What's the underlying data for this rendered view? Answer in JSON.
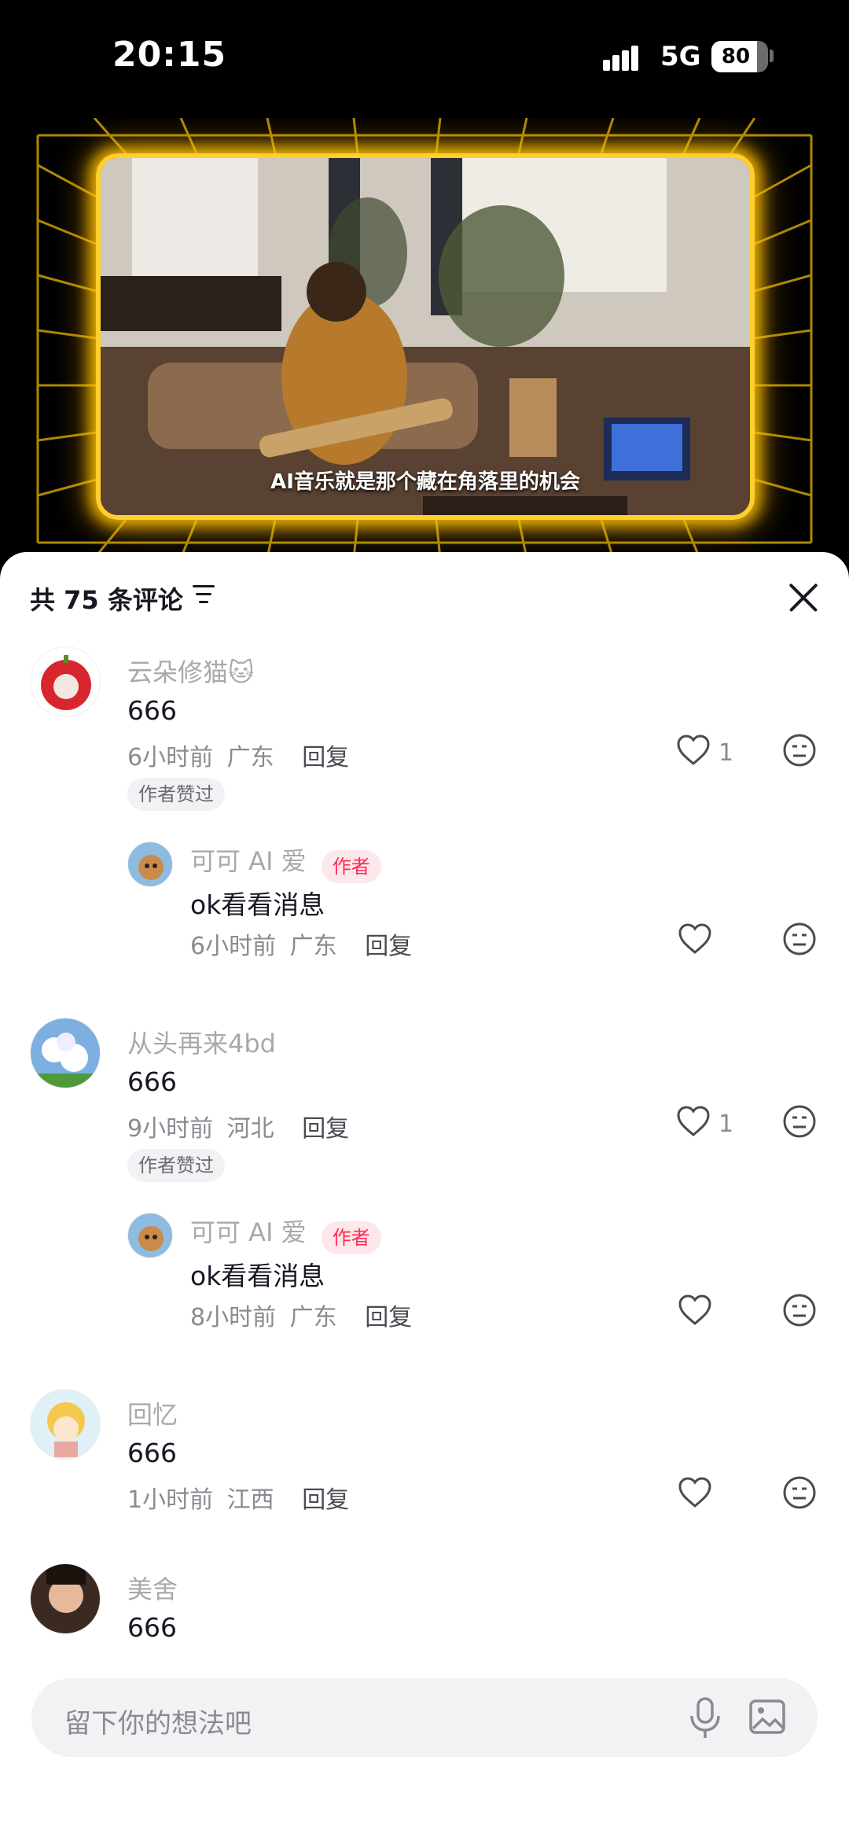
{
  "status_bar": {
    "time": "20:15",
    "network": "5G",
    "battery": "80",
    "battery_level": 0.8
  },
  "video": {
    "subtitle": "AI音乐就是那个藏在角落里的机会"
  },
  "comments_panel": {
    "title": "共 75 条评论",
    "input_placeholder": "留下你的想法吧",
    "comments": [
      {
        "user": "云朵修猫🐱",
        "text": "666",
        "time": "6小时前",
        "location": "广东",
        "reply": "回复",
        "likes": "1",
        "tag": "作者赞过",
        "replies": [
          {
            "user": "可可 AI 爱",
            "badge": "作者",
            "text": "ok看看消息",
            "time": "6小时前",
            "location": "广东",
            "reply": "回复"
          }
        ]
      },
      {
        "user": "从头再来4bd",
        "text": "666",
        "time": "9小时前",
        "location": "河北",
        "reply": "回复",
        "likes": "1",
        "tag": "作者赞过",
        "replies": [
          {
            "user": "可可 AI 爱",
            "badge": "作者",
            "text": "ok看看消息",
            "time": "8小时前",
            "location": "广东",
            "reply": "回复"
          }
        ]
      },
      {
        "user": "回忆",
        "text": "666",
        "time": "1小时前",
        "location": "江西",
        "reply": "回复"
      },
      {
        "user": "美舍",
        "text": "666"
      }
    ]
  },
  "colors": {
    "accent": "#fe2c55",
    "glow": "#ffcf2e"
  }
}
